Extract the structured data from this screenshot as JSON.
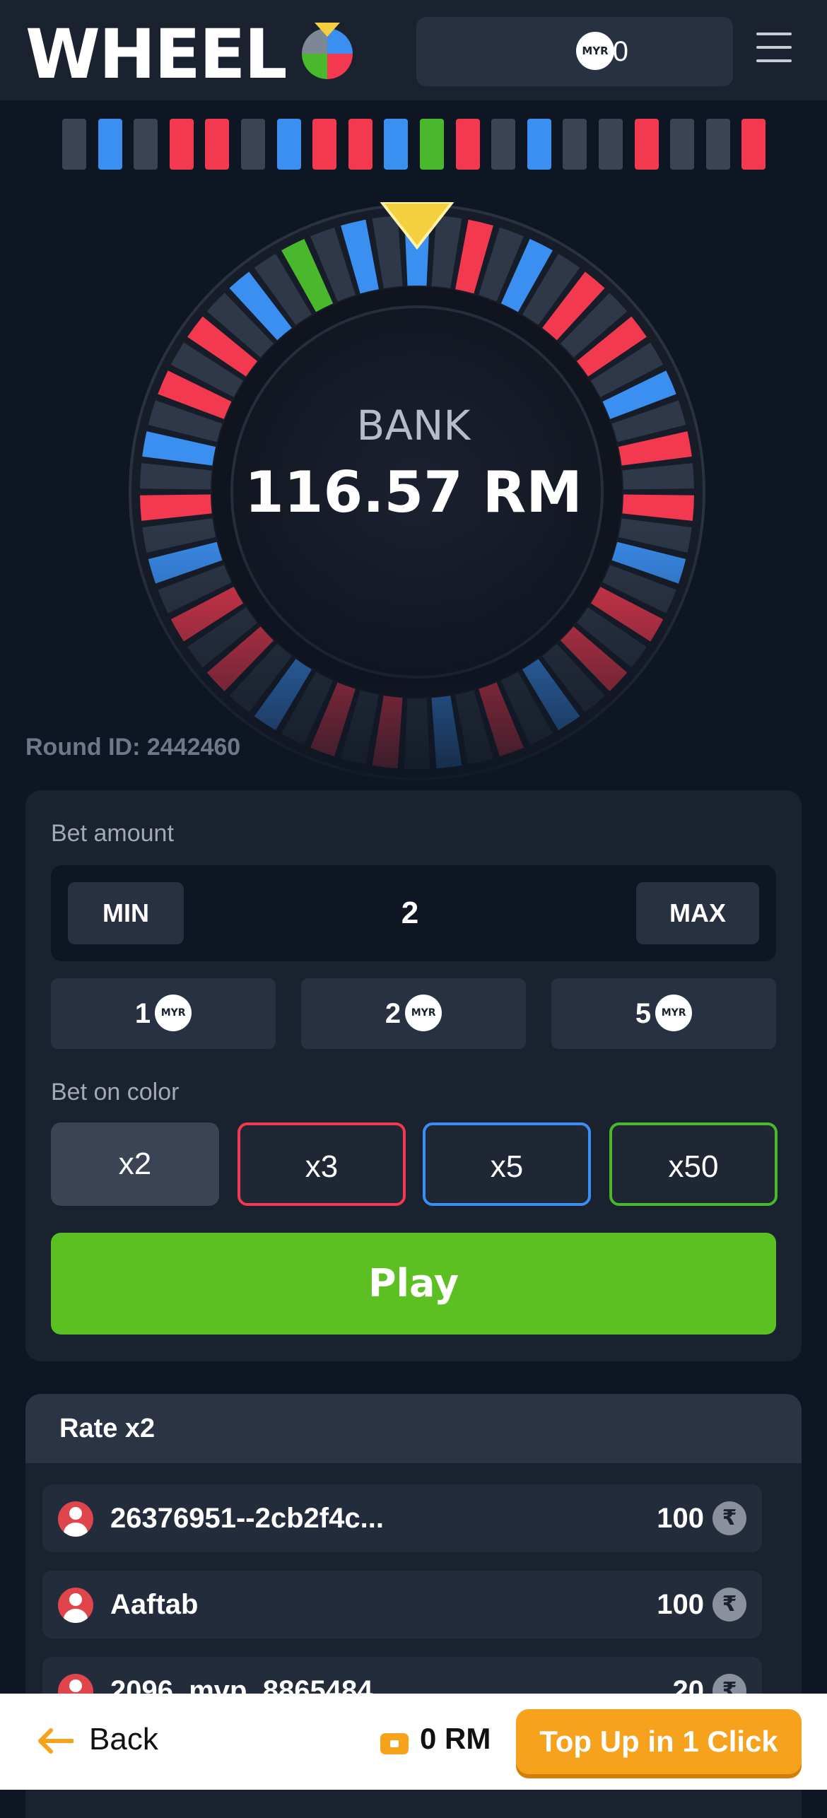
{
  "header": {
    "logo_text": "WHEEL",
    "balance": "0",
    "currency_badge": "MYR"
  },
  "history": [
    "gray",
    "blue",
    "gray",
    "red",
    "red",
    "gray",
    "blue",
    "red",
    "red",
    "blue",
    "green",
    "red",
    "gray",
    "blue",
    "gray",
    "gray",
    "red",
    "gray",
    "gray",
    "red"
  ],
  "colors": {
    "gray": "#3a4454",
    "blue": "#3b8ff0",
    "red": "#f2394f",
    "green": "#49b82d",
    "accent_green": "#5cbf22",
    "accent_orange": "#f6a21d"
  },
  "wheel": {
    "label": "BANK",
    "bank": "116.57 RM"
  },
  "round": {
    "label": "Round ID: 2442460"
  },
  "bet": {
    "amount_label": "Bet amount",
    "min_label": "MIN",
    "max_label": "MAX",
    "amount_value": "2",
    "quick": [
      {
        "value": "1",
        "badge": "MYR"
      },
      {
        "value": "2",
        "badge": "MYR"
      },
      {
        "value": "5",
        "badge": "MYR"
      }
    ],
    "color_label": "Bet on color",
    "options": [
      "x2",
      "x3",
      "x5",
      "x50"
    ],
    "play_label": "Play"
  },
  "rate": {
    "title": "Rate x2",
    "players": [
      {
        "name": "26376951--2cb2f4c...",
        "amount": "100",
        "icon": "rupee-icon"
      },
      {
        "name": "Aaftab",
        "amount": "100",
        "icon": "rupee-icon"
      },
      {
        "name": "2096_mvp_8865484",
        "amount": "20",
        "icon": "rupee-icon"
      }
    ]
  },
  "bottom": {
    "back_label": "Back",
    "wallet_amount": "0 RM",
    "topup_label": "Top Up in 1 Click"
  }
}
